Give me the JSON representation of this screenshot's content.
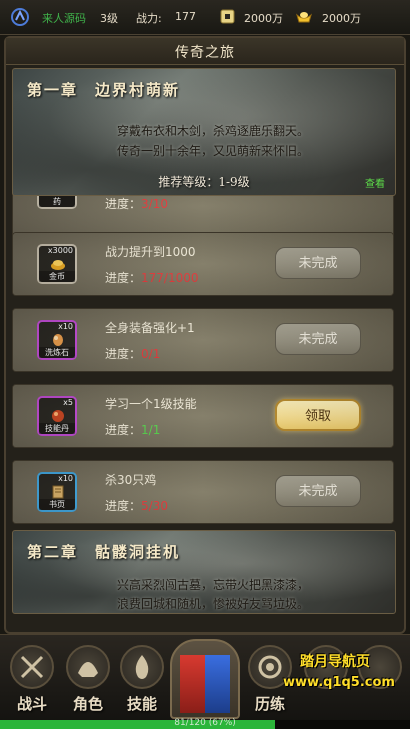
{
  "topbar": {
    "player_name": "来人源码",
    "level": "3级",
    "power_label": "战力:",
    "power_value": "177",
    "coin_value": "2000万",
    "gold_value": "2000万"
  },
  "panel": {
    "title": "传奇之旅"
  },
  "chapter1": {
    "title": "第一章　边界村萌新",
    "desc_line1": "穿戴布衣和木剑，杀鸡逐鹿乐翻天。",
    "desc_line2": "传奇一别十余年，又见萌新来怀旧。",
    "recommend": "推荐等级：1-9级",
    "view_label": "查看"
  },
  "tasks": [
    {
      "name": "",
      "progress_label": "进度：",
      "progress": "3/10",
      "item_qty": "",
      "item_name": "微型金创药",
      "button": ""
    },
    {
      "name": "战力提升到1000",
      "progress_label": "进度：",
      "progress": "177/1000",
      "item_qty": "x3000",
      "item_name": "金币",
      "button": "未完成"
    },
    {
      "name": "全身装备强化+1",
      "progress_label": "进度：",
      "progress": "0/1",
      "item_qty": "x10",
      "item_name": "洗炼石",
      "button": "未完成"
    },
    {
      "name": "学习一个1级技能",
      "progress_label": "进度：",
      "progress": "1/1",
      "item_qty": "x5",
      "item_name": "技能丹",
      "button": "领取"
    },
    {
      "name": "杀30只鸡",
      "progress_label": "进度：",
      "progress": "5/30",
      "item_qty": "x10",
      "item_name": "书页",
      "button": "未完成"
    }
  ],
  "chapter2": {
    "title": "第二章　骷髅洞挂机",
    "desc_line1": "兴高采烈闯古墓，忘带火把黑漆漆，",
    "desc_line2": "浪费回城和随机，惨被好友骂垃圾。"
  },
  "bottomnav": {
    "items": [
      "战斗",
      "角色",
      "技能",
      "历练"
    ]
  },
  "watermark": {
    "title": "踏月导航页",
    "url": "www.q1q5.com"
  },
  "exp": {
    "text": "81/120 (67%)",
    "fraction": 0.67
  },
  "colors": {
    "progress_incomplete": "#e4383a",
    "progress_complete": "#57d34c",
    "exp_fill": "#2bb53a"
  }
}
